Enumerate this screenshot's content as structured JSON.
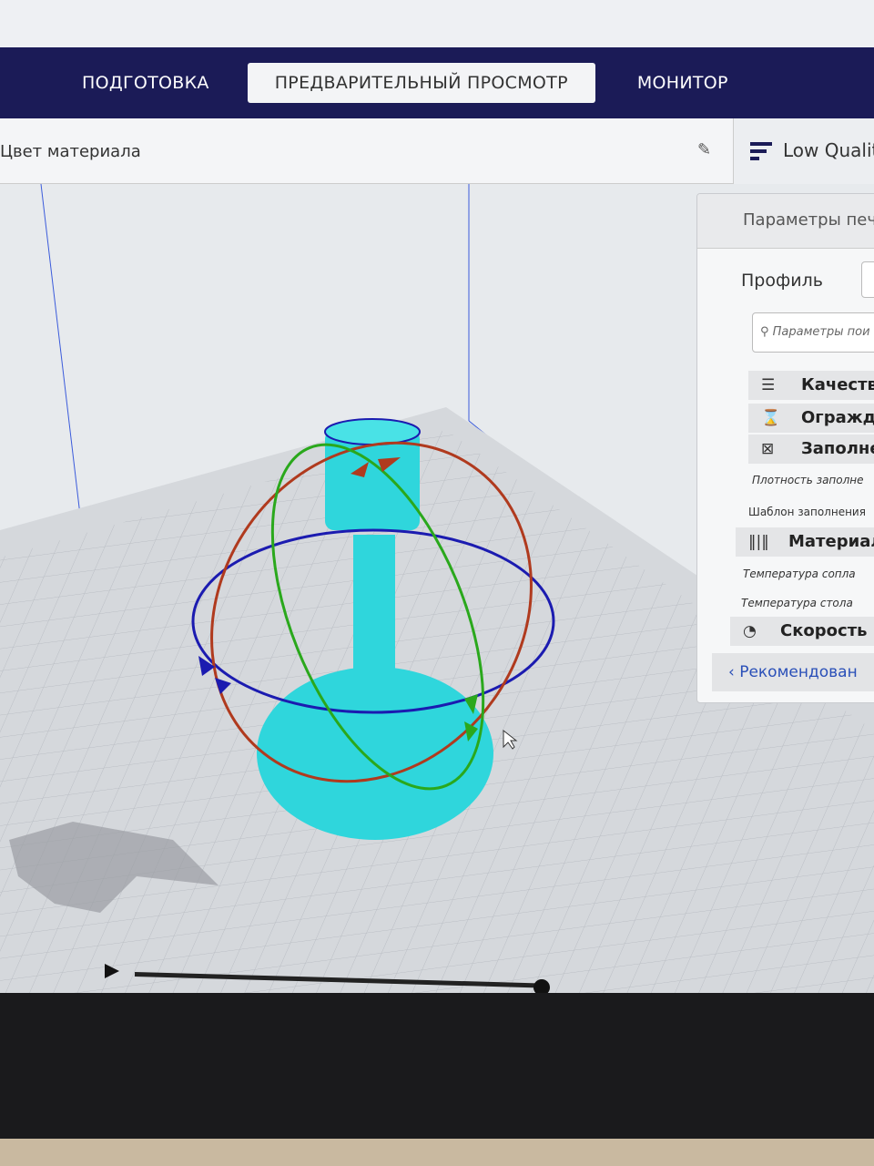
{
  "tabs": [
    {
      "label": "ПОДГОТОВКА"
    },
    {
      "label": "ПРЕДВАРИТЕЛЬНЫЙ ПРОСМОТР"
    },
    {
      "label": "МОНИТОР"
    }
  ],
  "toolbar": {
    "color_scheme_label": "Цвет материала",
    "edit_icon": "pencil-icon"
  },
  "quality": {
    "label": "Low Quality"
  },
  "panel": {
    "title": "Параметры печ",
    "profile_label": "Профиль",
    "search_placeholder": "Параметры пои",
    "categories": {
      "quality": "Качеств",
      "shell": "Огражде",
      "infill": "Заполнен",
      "infill_density": "Плотность заполне",
      "infill_pattern": "Шаблон заполнения",
      "material": "Материал",
      "nozzle_temp": "Температура сопла",
      "bed_temp": "Температура стола",
      "speed": "Скорость"
    },
    "recommended_button": "Рекомендован"
  },
  "colors": {
    "header": "#1b1b57",
    "model": "#2fd6dc",
    "rotate_x": "#b03a1e",
    "rotate_y": "#2aa81c",
    "rotate_z": "#1b1bb0"
  },
  "layer_slider": {
    "value_fraction": 1.0
  }
}
